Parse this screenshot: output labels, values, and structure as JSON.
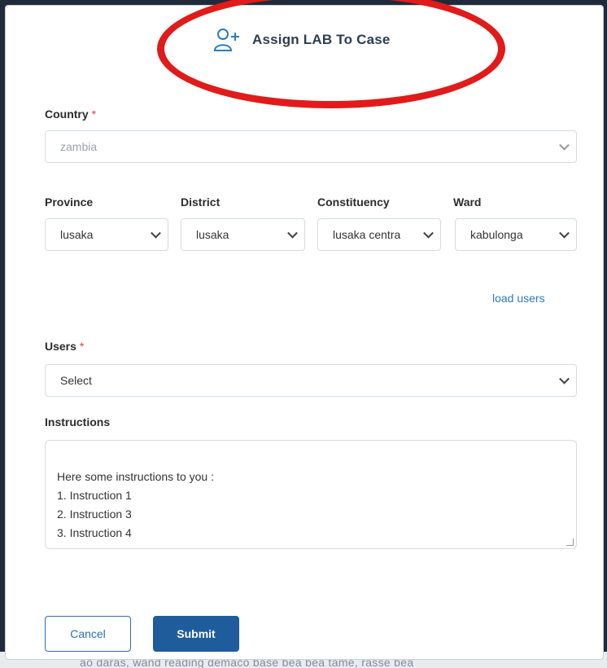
{
  "dialog": {
    "title": "Assign LAB To Case",
    "title_icon": "add-user-icon"
  },
  "country": {
    "label": "Country",
    "required_mark": "*",
    "value": "zambia"
  },
  "province": {
    "label": "Province",
    "value": "lusaka"
  },
  "district": {
    "label": "District",
    "value": "lusaka"
  },
  "constituency": {
    "label": "Constituency",
    "value": "lusaka centra"
  },
  "ward": {
    "label": "Ward",
    "value": "kabulonga"
  },
  "load_users_link": "load users",
  "users": {
    "label": "Users",
    "required_mark": "*",
    "value": "Select"
  },
  "instructions": {
    "label": "Instructions",
    "value": "Here some instructions to you :\n 1. Instruction 1\n 2. Instruction 3\n 3. Instruction 4\n ..."
  },
  "buttons": {
    "cancel": "Cancel",
    "submit": "Submit"
  },
  "background_text": "ao daras, wand reading demaco base bea bea tame, rasse bea",
  "colors": {
    "accent": "#1e5c9c",
    "link": "#2b7bbf",
    "required": "#e03e3e",
    "annotation": "#e11a1a"
  }
}
